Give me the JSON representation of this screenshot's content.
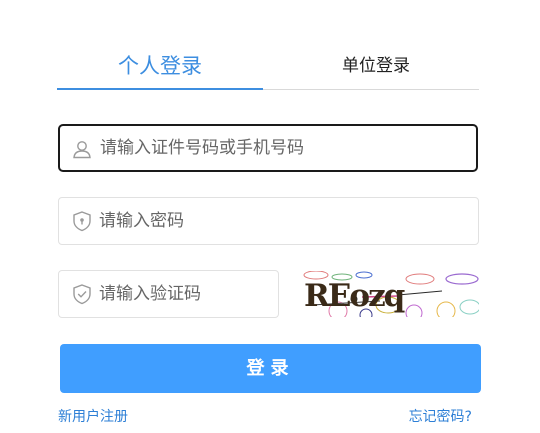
{
  "tabs": {
    "personal": "个人登录",
    "unit": "单位登录"
  },
  "form": {
    "account_placeholder": "请输入证件号码或手机号码",
    "password_placeholder": "请输入密码",
    "captcha_placeholder": "请输入验证码",
    "captcha_text": "REozq"
  },
  "buttons": {
    "login": "登录"
  },
  "links": {
    "register": "新用户注册",
    "forgot": "忘记密码?"
  },
  "colors": {
    "accent": "#409eff",
    "tab_active": "#3d8ee0",
    "link": "#2d7fd6"
  }
}
